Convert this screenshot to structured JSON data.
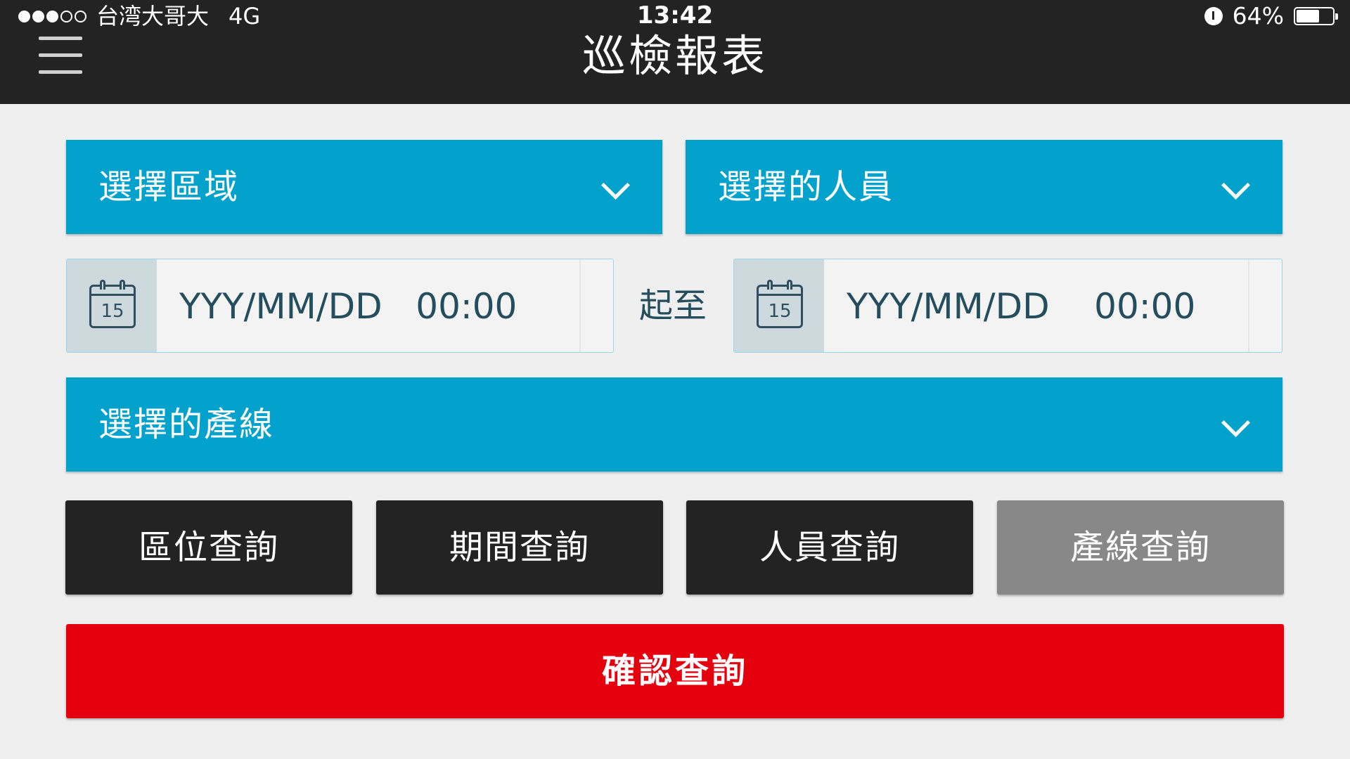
{
  "status_bar": {
    "carrier": "台湾大哥大",
    "network": "4G",
    "signal_bars_filled": 3,
    "signal_bars_total": 5,
    "time": "13:42",
    "battery_percent_label": "64%",
    "battery_level": 0.64
  },
  "header": {
    "title": "巡檢報表",
    "menu_icon": "hamburger-menu-icon"
  },
  "filters": {
    "area_dropdown": {
      "label": "選擇區域",
      "icon": "chevron-down-icon"
    },
    "personnel_dropdown": {
      "label": "選擇的人員",
      "icon": "chevron-down-icon"
    },
    "date_start": {
      "value": "YYY/MM/DD   00:00",
      "calendar_day": "15",
      "icon": "calendar-icon"
    },
    "range_separator": "起至",
    "date_end": {
      "value": "YYY/MM/DD    00:00",
      "calendar_day": "15",
      "icon": "calendar-icon"
    },
    "line_dropdown": {
      "label": "選擇的產線",
      "icon": "chevron-down-icon"
    }
  },
  "query_buttons": [
    {
      "label": "區位查詢",
      "active": true
    },
    {
      "label": "期間查詢",
      "active": true
    },
    {
      "label": "人員查詢",
      "active": true
    },
    {
      "label": "產線查詢",
      "active": false
    }
  ],
  "confirm_button": {
    "label": "確認查詢"
  },
  "colors": {
    "topbar": "#232323",
    "dropdown": "#03a2cc",
    "query_button": "#232323",
    "query_button_inactive": "#888888",
    "confirm": "#e5000e",
    "background": "#efefef"
  }
}
